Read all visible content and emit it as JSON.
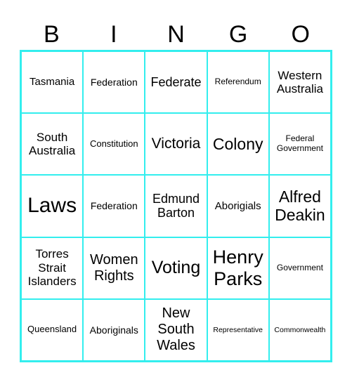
{
  "header": [
    "B",
    "I",
    "N",
    "G",
    "O"
  ],
  "border_color": "#33eeee",
  "cells": [
    "Tasmania",
    "Federation",
    "Federate",
    "Referendum",
    "Western Australia",
    "South Australia",
    "Constitution",
    "Victoria",
    "Colony",
    "Federal Government",
    "Laws",
    "Federation",
    "Edmund Barton",
    "Aborigials",
    "Alfred Deakin",
    "Torres Strait Islanders",
    "Women Rights",
    "Voting",
    "Henry Parks",
    "Government",
    "Queensland",
    "Aboriginals",
    "New South Wales",
    "Representative",
    "Commonwealth"
  ]
}
